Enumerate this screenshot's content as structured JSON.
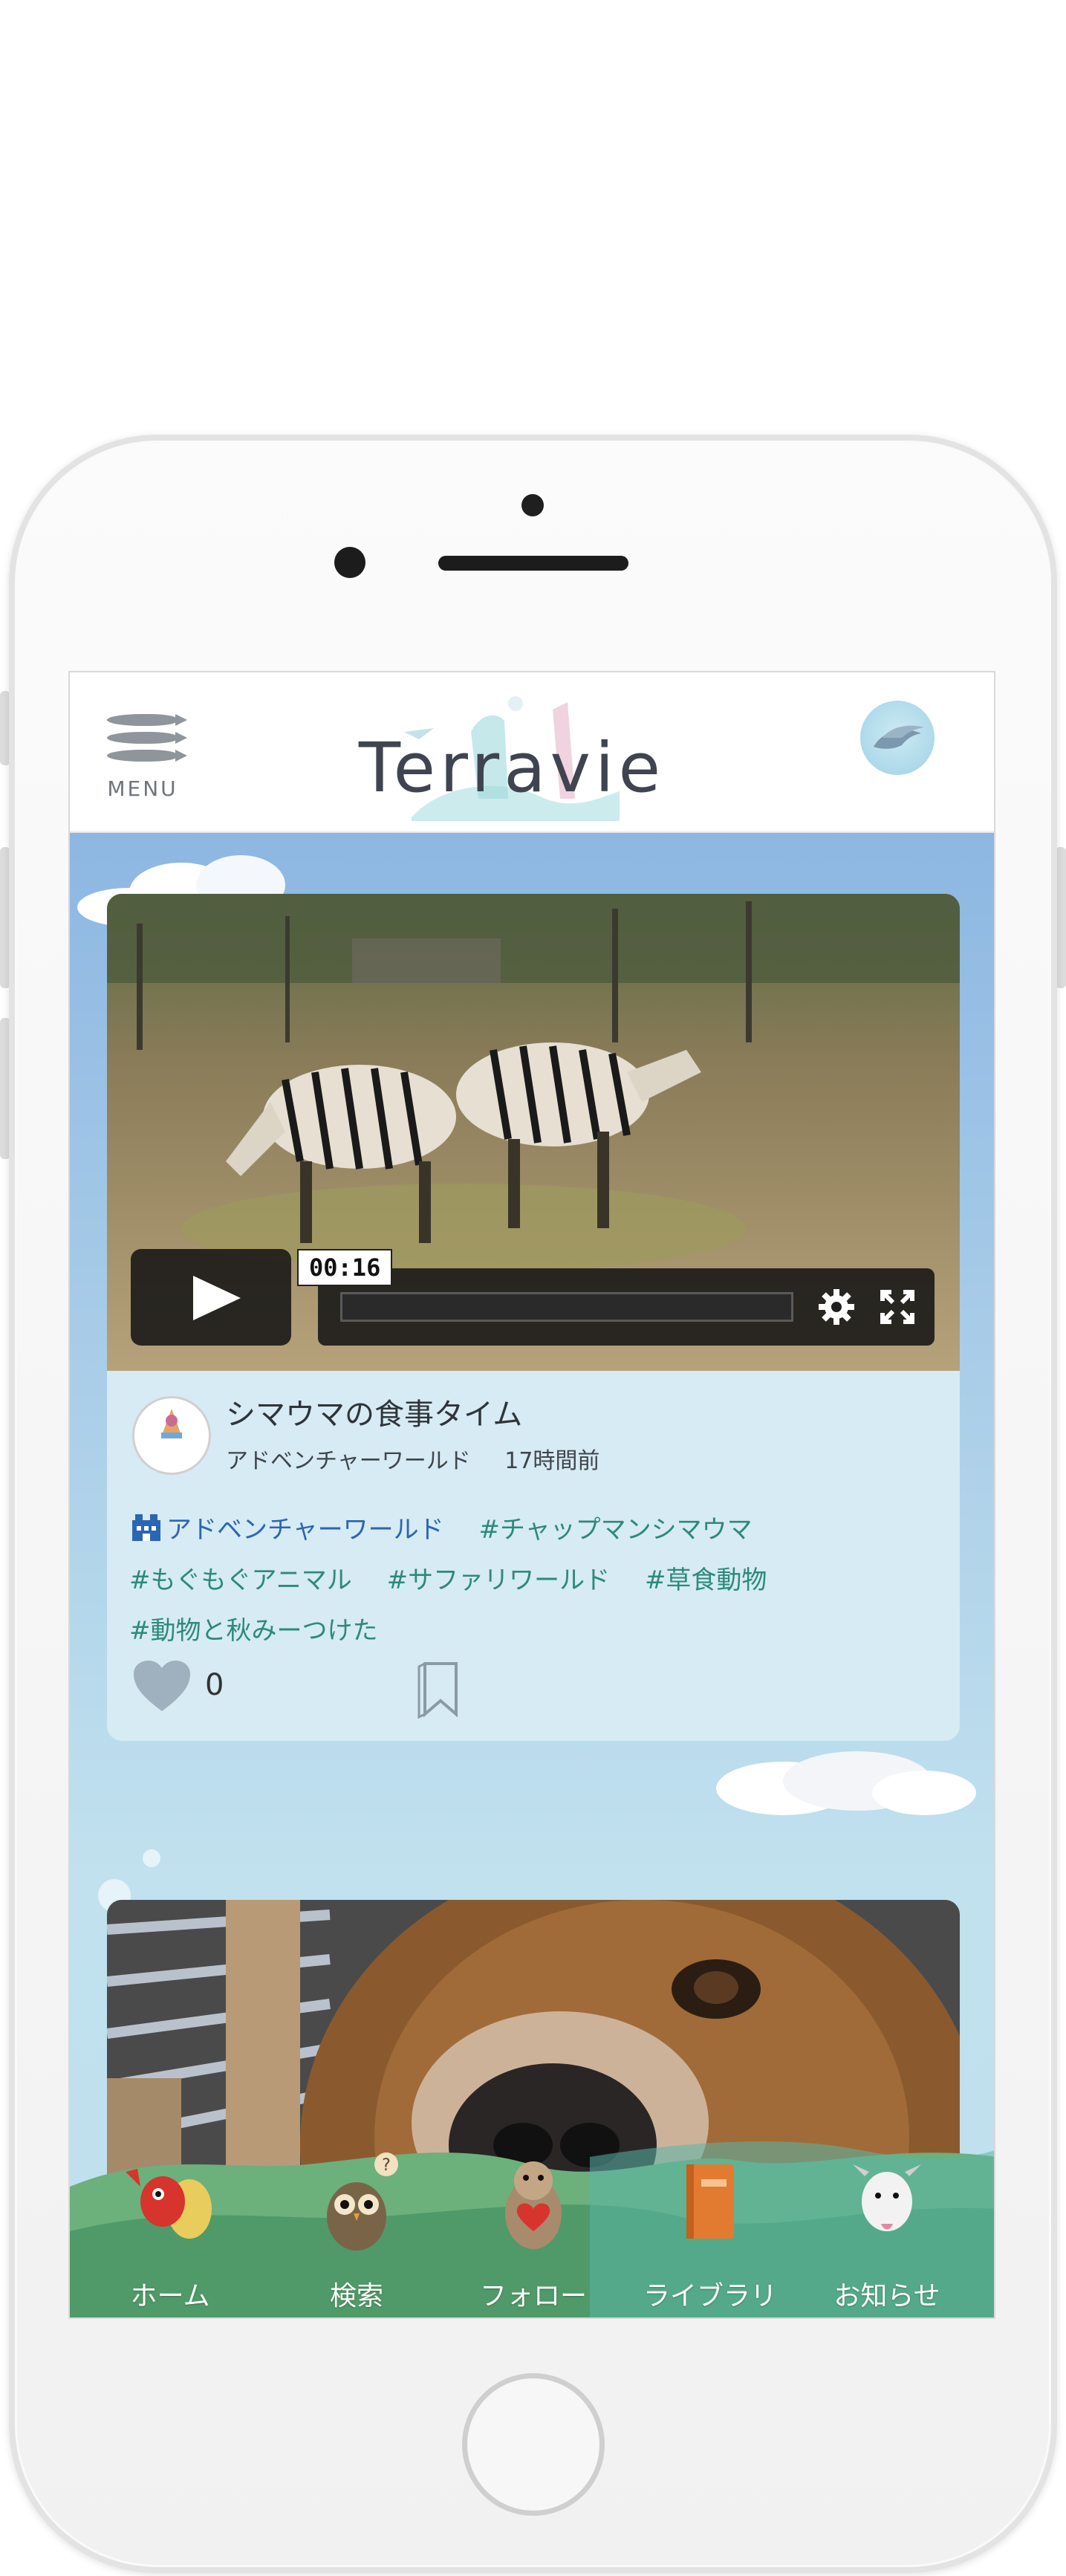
{
  "app": {
    "menu_label": "MENU",
    "logo_text": "Terravie"
  },
  "posts": [
    {
      "video_time": "00:16",
      "title": "シマウマの食事タイム",
      "author": "アドベンチャーワールド",
      "posted_ago": "17時間前",
      "org_tag": "アドベンチャーワールド",
      "tags": [
        "#チャップマンシマウマ",
        "#もぐもぐアニマル",
        "#サファリワールド",
        "#草食動物",
        "#動物と秋みーつけた"
      ],
      "likes": "0"
    }
  ],
  "tabs": [
    {
      "label": "ホーム",
      "icon": "hermit-crab-icon"
    },
    {
      "label": "検索",
      "icon": "owl-icon"
    },
    {
      "label": "フォロー",
      "icon": "otter-heart-icon"
    },
    {
      "label": "ライブラリ",
      "icon": "book-icon"
    },
    {
      "label": "お知らせ",
      "icon": "goat-icon"
    }
  ],
  "colors": {
    "sky": "#9fc3e6",
    "card": "#d6ebf3",
    "tag": "#2d8a7a",
    "org_tag": "#2a66b3",
    "tabbar_green": "#5aa878"
  }
}
